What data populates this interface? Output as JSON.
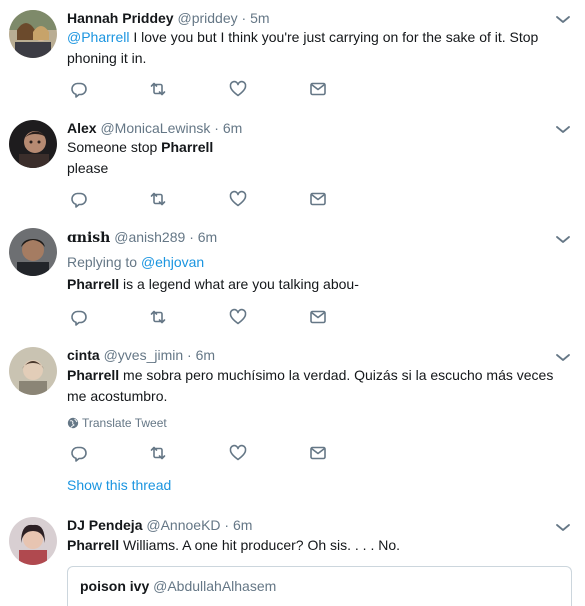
{
  "colors": {
    "link": "#1b95e0",
    "meta": "#657786",
    "text": "#14171a",
    "divider": "#e6ecf0"
  },
  "tweets": [
    {
      "fullname": "Hannah Priddey",
      "screenname": "@priddey",
      "separator": "·",
      "time": "5m",
      "mention": "@Pharrell",
      "text": " I love you but I think you're just carrying on for the sake of it. Stop phoning it in."
    },
    {
      "fullname": "Alex",
      "screenname": "@MonicaLewinsk",
      "separator": "·",
      "time": "6m",
      "bold": "Pharrell",
      "prefix": "Someone stop ",
      "line2": "please"
    },
    {
      "fullname": "ɑnish",
      "screenname": "@anish289",
      "separator": "·",
      "time": "6m",
      "replying_label": "Replying to ",
      "replying_to": "@ehjovan",
      "bold": "Pharrell",
      "text": " is a legend what are you talking abou-"
    },
    {
      "fullname": "cinta",
      "screenname": "@yves_jimin",
      "separator": "·",
      "time": "6m",
      "bold": "Pharrell",
      "text": " me sobra pero muchísimo la verdad. Quizás si la escucho más veces me acostumbro.",
      "translate": "Translate Tweet",
      "show_thread": "Show this thread"
    },
    {
      "fullname": "DJ Pendeja",
      "screenname": "@AnnoeKD",
      "separator": "·",
      "time": "6m",
      "bold": "Pharrell",
      "text": " Williams. A one hit producer? Oh sis. . . . No.",
      "quote": {
        "fullname": "poison ivy",
        "screenname": "@AbdullahAlhasem"
      }
    }
  ],
  "icons": [
    "reply-icon",
    "retweet-icon",
    "like-icon",
    "direct-message-icon",
    "caret-down-icon",
    "globe-icon"
  ]
}
